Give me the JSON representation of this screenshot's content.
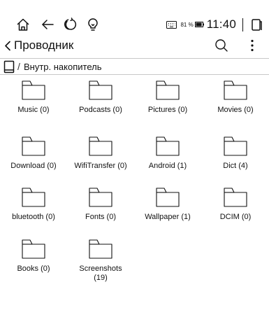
{
  "status_bar": {
    "icons": [
      "home-icon",
      "back-arrow-icon",
      "refresh-icon",
      "lightbulb-icon"
    ],
    "keyboard_icon": "keyboard-icon",
    "battery_percent": "81 %",
    "battery_level": 0.81,
    "time": "11:40",
    "window_icon": "window-icon"
  },
  "app_bar": {
    "title": "Проводник",
    "back_icon": "chevron-left-icon",
    "search_icon": "search-icon",
    "more_icon": "more-vertical-icon"
  },
  "path_bar": {
    "device_icon": "tablet-icon",
    "separator": "/",
    "location": "Внутр. накопитель"
  },
  "folders": [
    {
      "label": "Music (0)"
    },
    {
      "label": "Podcasts (0)"
    },
    {
      "label": "Pictures (0)"
    },
    {
      "label": "Movies (0)"
    },
    {
      "label": "Download (0)"
    },
    {
      "label": "WifiTransfer (0)"
    },
    {
      "label": "Android (1)"
    },
    {
      "label": "Dict (4)"
    },
    {
      "label": "bluetooth (0)"
    },
    {
      "label": "Fonts (0)"
    },
    {
      "label": "Wallpaper (1)"
    },
    {
      "label": "DCIM (0)"
    },
    {
      "label": "Books (0)"
    },
    {
      "label": "Screenshots (19)"
    }
  ],
  "colors": {
    "background": "#ffffff",
    "text": "#111111",
    "divider": "#c8c8c8"
  }
}
